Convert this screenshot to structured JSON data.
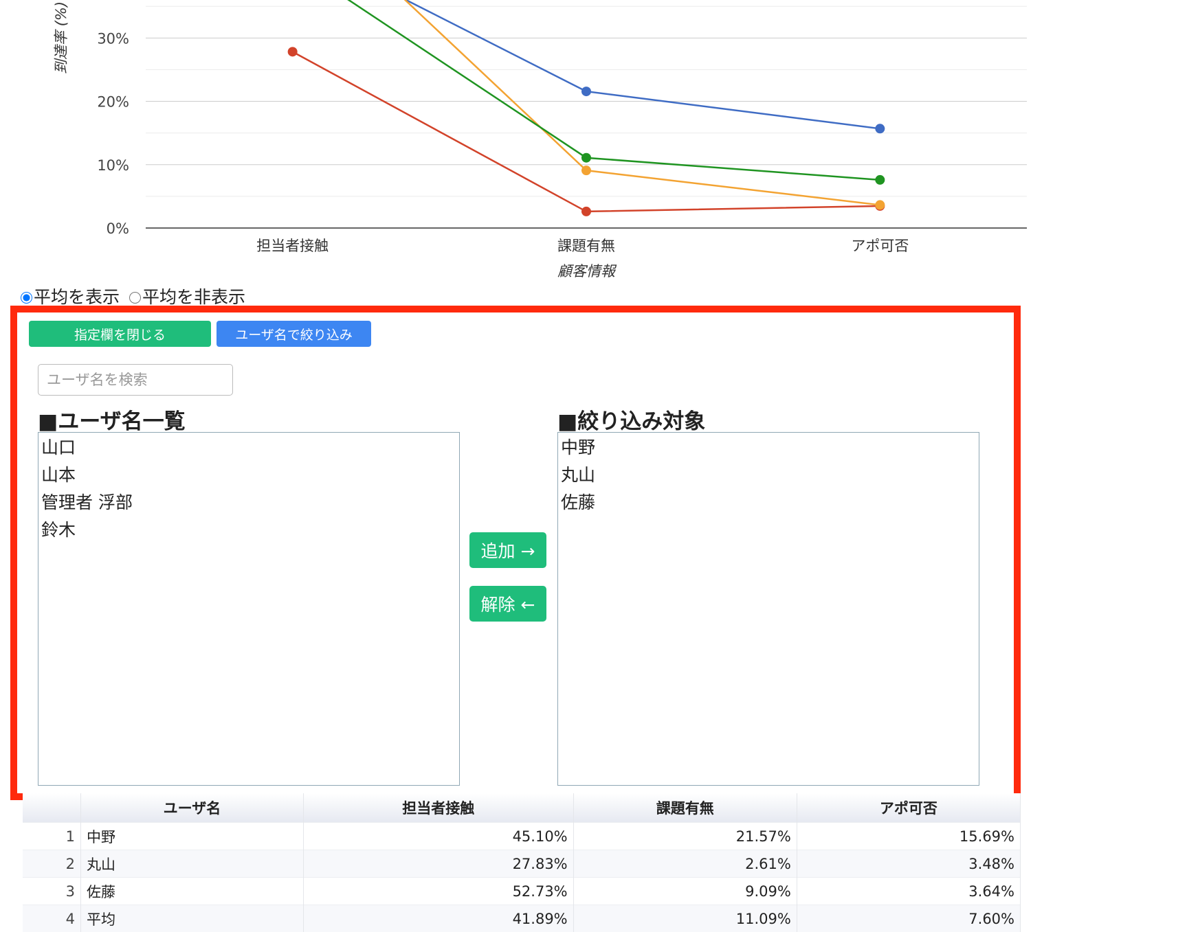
{
  "chart_data": {
    "type": "line",
    "xlabel": "顧客情報",
    "ylabel": "到達率 (%)",
    "categories": [
      "担当者接触",
      "課題有無",
      "アポ可否"
    ],
    "yticks": [
      "0%",
      "10%",
      "20%",
      "30%"
    ],
    "ylim": [
      0,
      36
    ],
    "grid": true,
    "series": [
      {
        "values": [
          45.1,
          21.57,
          15.69
        ],
        "color": "#3f6cc4"
      },
      {
        "values": [
          27.83,
          2.61,
          3.48
        ],
        "color": "#d2432a"
      },
      {
        "values": [
          52.73,
          9.09,
          3.64
        ],
        "color": "#f3a332"
      },
      {
        "values": [
          41.89,
          11.09,
          7.6
        ],
        "color": "#1f9421"
      }
    ]
  },
  "radio": {
    "show_avg": "平均を表示",
    "hide_avg": "平均を非表示"
  },
  "panel": {
    "close_label": "指定欄を閉じる",
    "filter_label": "ユーザ名で絞り込み",
    "search_placeholder": "ユーザ名を検索",
    "user_list_title": "■ユーザ名一覧",
    "user_list": [
      "山口",
      "山本",
      "管理者 浮部",
      "鈴木"
    ],
    "add_label": "追加 →",
    "remove_label": "解除 ←",
    "target_title": "■絞り込み対象",
    "target_list": [
      "中野",
      "丸山",
      "佐藤"
    ]
  },
  "table": {
    "headers": [
      "",
      "ユーザ名",
      "担当者接触",
      "課題有無",
      "アポ可否"
    ],
    "rows": [
      [
        "1",
        "中野",
        "45.10%",
        "21.57%",
        "15.69%"
      ],
      [
        "2",
        "丸山",
        "27.83%",
        "2.61%",
        "3.48%"
      ],
      [
        "3",
        "佐藤",
        "52.73%",
        "9.09%",
        "3.64%"
      ],
      [
        "4",
        "平均",
        "41.89%",
        "11.09%",
        "7.60%"
      ]
    ]
  }
}
